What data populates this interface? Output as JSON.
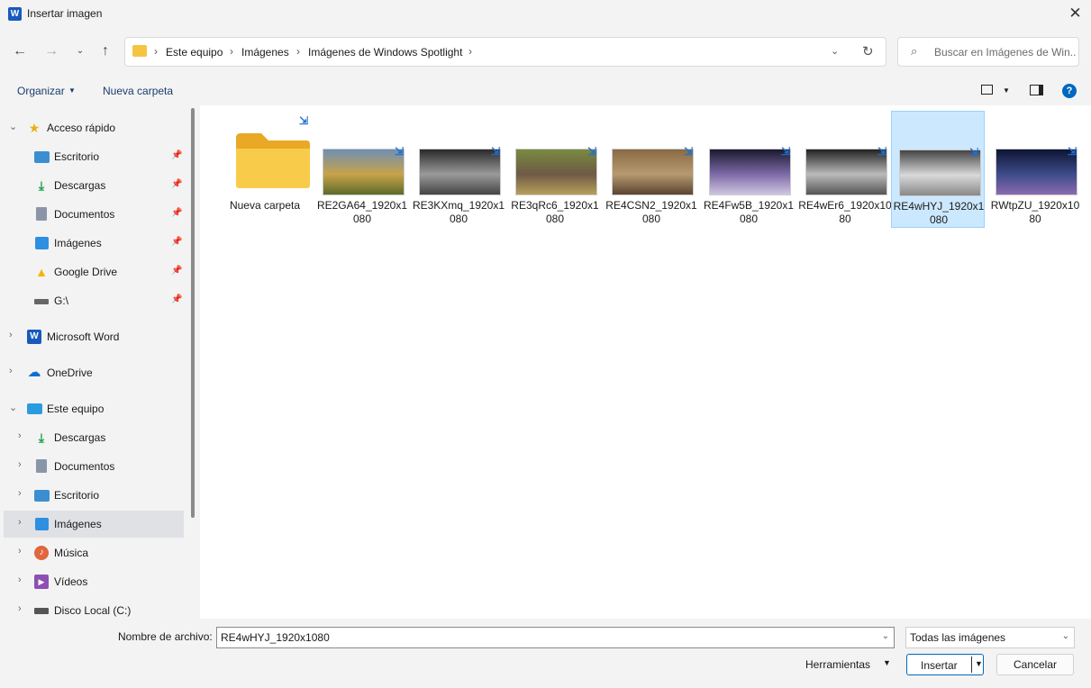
{
  "window": {
    "title": "Insertar imagen",
    "app_icon_letter": "W"
  },
  "nav": {
    "breadcrumb": [
      "Este equipo",
      "Imágenes",
      "Imágenes de Windows Spotlight"
    ],
    "search_placeholder": "Buscar en Imágenes de Win..."
  },
  "commands": {
    "organize": "Organizar",
    "new_folder": "Nueva carpeta"
  },
  "sidebar": {
    "quick_access": "Acceso rápido",
    "quick_items": [
      "Escritorio",
      "Descargas",
      "Documentos",
      "Imágenes",
      "Google Drive",
      "G:\\"
    ],
    "word": "Microsoft Word",
    "onedrive": "OneDrive",
    "this_pc": "Este equipo",
    "pc_items": [
      "Descargas",
      "Documentos",
      "Escritorio",
      "Imágenes",
      "Música",
      "Vídeos",
      "Disco Local (C:)"
    ]
  },
  "files": [
    {
      "name": "Nueva carpeta",
      "type": "folder"
    },
    {
      "name": "RE2GA64_1920x1080",
      "type": "image",
      "colors": [
        "#6e8fb3",
        "#c9a34a",
        "#5d6b2a"
      ]
    },
    {
      "name": "RE3KXmq_1920x1080",
      "type": "image",
      "colors": [
        "#2a2a2a",
        "#9a9a9a",
        "#444"
      ]
    },
    {
      "name": "RE3qRc6_1920x1080",
      "type": "image",
      "colors": [
        "#7a8a40",
        "#6e5a46",
        "#b7a05a"
      ]
    },
    {
      "name": "RE4CSN2_1920x1080",
      "type": "image",
      "colors": [
        "#8a6a44",
        "#b79a70",
        "#5a4430"
      ]
    },
    {
      "name": "RE4Fw5B_1920x1080",
      "type": "image",
      "colors": [
        "#1a1a2e",
        "#7e6aa8",
        "#cfc6e0"
      ]
    },
    {
      "name": "RE4wEr6_1920x1080",
      "type": "image",
      "colors": [
        "#222",
        "#bbb",
        "#555"
      ]
    },
    {
      "name": "RE4wHYJ_1920x1080",
      "type": "image",
      "colors": [
        "#444",
        "#d9d9d9",
        "#888"
      ]
    },
    {
      "name": "RWtpZU_1920x1080",
      "type": "image",
      "colors": [
        "#0d1533",
        "#3e4b8a",
        "#8a6ab0"
      ]
    }
  ],
  "selected_file": "RE4wHYJ_1920x1080",
  "footer": {
    "filename_label": "Nombre de archivo:",
    "filename_value": "RE4wHYJ_1920x1080",
    "filter_value": "Todas las imágenes",
    "tools_label": "Herramientas",
    "insert_label": "Insertar",
    "cancel_label": "Cancelar"
  }
}
